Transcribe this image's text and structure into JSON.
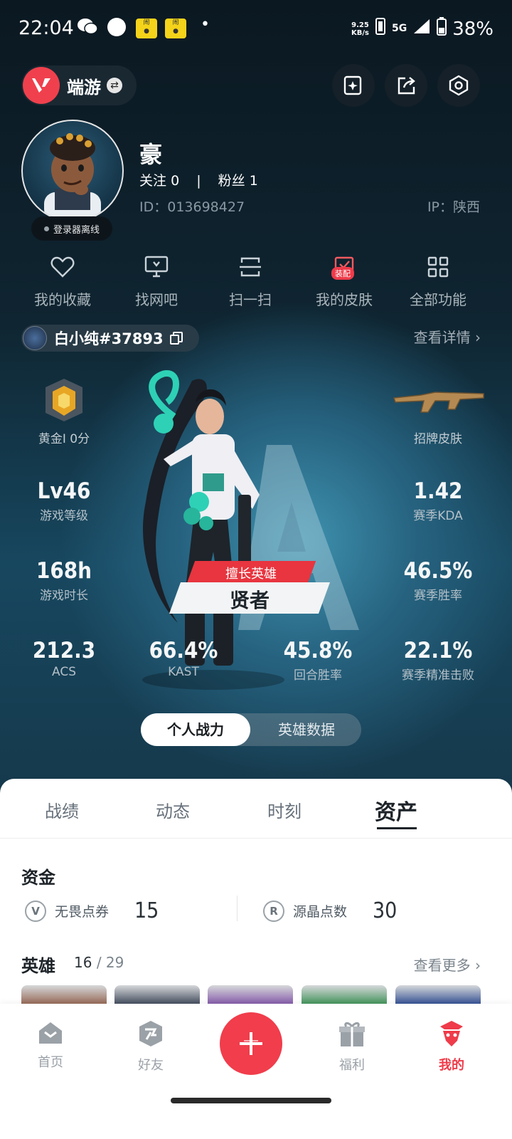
{
  "status_bar": {
    "time": "22:04",
    "net_speed": "9.25",
    "net_unit": "KB/s",
    "network": "5G",
    "battery": "38%"
  },
  "header": {
    "game_name": "端游"
  },
  "profile": {
    "username": "豪",
    "follow_label": "关注",
    "follow_count": "0",
    "fans_label": "粉丝",
    "fans_count": "1",
    "id_text": "ID：013698427",
    "ip_text": "IP：陕西",
    "status_text": "登录器离线"
  },
  "quick_functions": [
    {
      "label": "我的收藏",
      "icon": "heart-icon"
    },
    {
      "label": "找网吧",
      "icon": "monitor-icon"
    },
    {
      "label": "扫一扫",
      "icon": "scan-icon"
    },
    {
      "label": "我的皮肤",
      "icon": "skin-icon",
      "badge": "装配"
    },
    {
      "label": "全部功能",
      "icon": "grid-icon"
    }
  ],
  "player": {
    "tag": "白小纯#37893",
    "details_label": "查看详情"
  },
  "stats": {
    "rank_label": "黄金I 0分",
    "skin_label": "招牌皮肤",
    "level_value": "Lv46",
    "level_label": "游戏等级",
    "hours_value": "168h",
    "hours_label": "游戏时长",
    "kda_value": "1.42",
    "kda_label": "赛季KDA",
    "winrate_value": "46.5%",
    "winrate_label": "赛季胜率",
    "acs_value": "212.3",
    "acs_label": "ACS",
    "kast_value": "66.4%",
    "kast_label": "KAST",
    "round_value": "45.8%",
    "round_label": "回合胜率",
    "headshot_value": "22.1%",
    "headshot_label": "赛季精准击败",
    "hero_tag": "擅长英雄",
    "hero_name": "贤者"
  },
  "toggle": {
    "active": "个人战力",
    "inactive": "英雄数据"
  },
  "tabs": [
    "战绩",
    "动态",
    "时刻",
    "资产"
  ],
  "assets": {
    "funds_title": "资金",
    "currency1_label": "无畏点券",
    "currency1_value": "15",
    "currency2_label": "源晶点数",
    "currency2_value": "30",
    "heroes_title": "英雄",
    "heroes_owned": "16",
    "heroes_total": "/ 29",
    "see_more": "查看更多"
  },
  "bottom_nav": [
    {
      "label": "首页",
      "icon": "home-icon"
    },
    {
      "label": "好友",
      "icon": "friends-icon"
    },
    {
      "label": "福利",
      "icon": "gift-icon"
    },
    {
      "label": "我的",
      "icon": "profile-icon",
      "active": true
    }
  ],
  "colors": {
    "accent": "#f13d4c",
    "sheet_bg": "#ffffff",
    "dark_bg": "#0f1d29"
  }
}
